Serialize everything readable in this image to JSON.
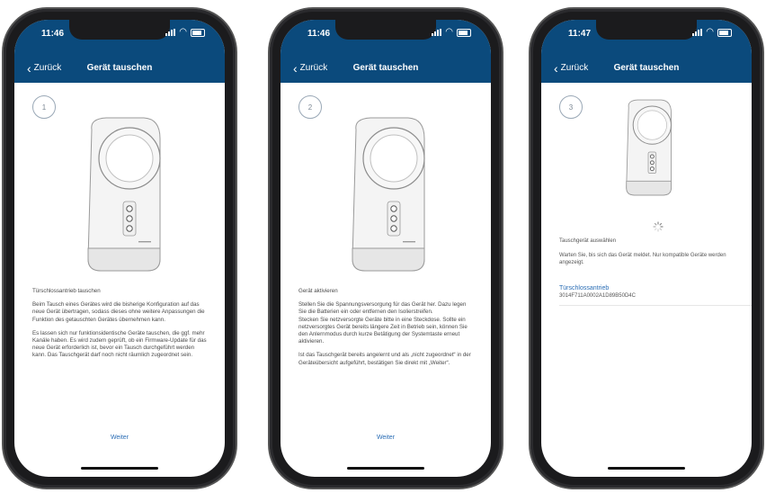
{
  "phones": [
    {
      "time": "11:46",
      "back_label": "Zurück",
      "title": "Gerät tauschen",
      "step": "1",
      "heading": "Türschlossantrieb tauschen",
      "paragraphs": [
        "Beim Tausch eines Gerätes wird die bisherige Konfiguration auf das neue Gerät übertragen, sodass dieses ohne weitere Anpassungen die Funktion des getauschten Gerätes übernehmen kann.",
        "Es lassen sich nur funktionsidentische Geräte tauschen, die ggf. mehr Kanäle haben. Es wird zudem geprüft, ob ein Firmware-Update für das neue Gerät erforderlich ist, bevor ein Tausch durchgeführt werden kann. Das Tauschgerät darf noch nicht räumlich zugeordnet sein."
      ],
      "button": "Weiter"
    },
    {
      "time": "11:46",
      "back_label": "Zurück",
      "title": "Gerät tauschen",
      "step": "2",
      "heading": "Gerät aktivieren",
      "paragraphs": [
        "Stellen Sie die Spannungsversorgung für das Gerät her. Dazu legen Sie die Batterien ein oder entfernen den Isolierstreifen.",
        "Stecken Sie netzversorgte Geräte bitte in eine Steckdose. Sollte ein netzversorgtes Gerät bereits längere Zeit in Betrieb sein, können Sie den Anlernmodus durch kurze Betätigung der Systemtaste erneut aktivieren.",
        "Ist das Tauschgerät bereits angelernt und als „nicht zugeordnet“ in der Geräteübersicht aufgeführt, bestätigen Sie direkt mit „Weiter“."
      ],
      "button": "Weiter"
    },
    {
      "time": "11:47",
      "back_label": "Zurück",
      "title": "Gerät tauschen",
      "step": "3",
      "select_label": "Tauschgerät auswählen",
      "wait_text": "Warten Sie, bis sich das Gerät meldet. Nur kompatible Geräte werden angezeigt.",
      "device_name": "Türschlossantrieb",
      "device_id": "3014F711A0002A1D89B50D4C"
    }
  ],
  "colors": {
    "header": "#0b4a7c",
    "link": "#2a6db5"
  }
}
